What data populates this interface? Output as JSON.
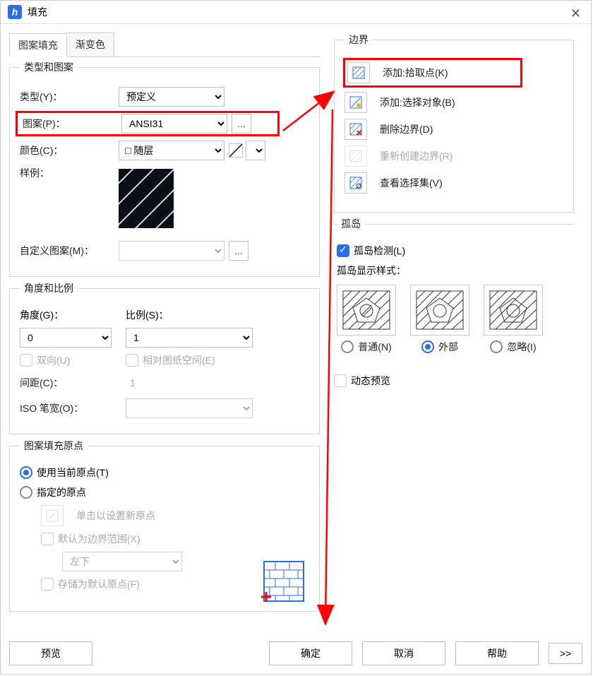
{
  "window": {
    "title": "填充"
  },
  "tabs": {
    "patternFill": "图案填充",
    "gradient": "渐变色"
  },
  "typePattern": {
    "legend": "类型和图案",
    "typeLabel": "类型(Y)：",
    "typeValue": "预定义",
    "patternLabel": "图案(P)：",
    "patternValue": "ANSI31",
    "moreBtn": "...",
    "colorLabel": "颜色(C)：",
    "colorValue": "随层",
    "sampleLabel": "样例：",
    "customLabel": "自定义图案(M)："
  },
  "angleScale": {
    "legend": "角度和比例",
    "angleLabel": "角度(G)：",
    "angleValue": "0",
    "scaleLabel": "比例(S)：",
    "scaleValue": "1",
    "doubleLabel": "双向(U)",
    "relPaperLabel": "相对图纸空间(E)",
    "spacingLabel": "间距(C)：",
    "spacingValue": "1",
    "isoPenLabel": "ISO 笔宽(O)："
  },
  "origin": {
    "legend": "图案填充原点",
    "useCurrent": "使用当前原点(T)",
    "specified": "指定的原点",
    "clickNew": "单击以设置新原点",
    "defaultExtents": "默认为边界范围(X)",
    "posValue": "左下",
    "storeDefault": "存储为默认原点(F)"
  },
  "boundary": {
    "legend": "边界",
    "pickPoints": "添加:拾取点(K)",
    "selectObjects": "添加:选择对象(B)",
    "removeBoundary": "删除边界(D)",
    "recreateBoundary": "重新创建边界(R)",
    "viewSelection": "查看选择集(V)"
  },
  "island": {
    "legend": "孤岛",
    "detect": "孤岛检测(L)",
    "styleLabel": "孤岛显示样式：",
    "normal": "普通(N)",
    "outer": "外部",
    "ignore": "忽略(I)"
  },
  "dynamic": {
    "preview": "动态预览"
  },
  "footer": {
    "preview": "预览",
    "ok": "确定",
    "cancel": "取消",
    "help": "帮助",
    "more": ">>"
  }
}
